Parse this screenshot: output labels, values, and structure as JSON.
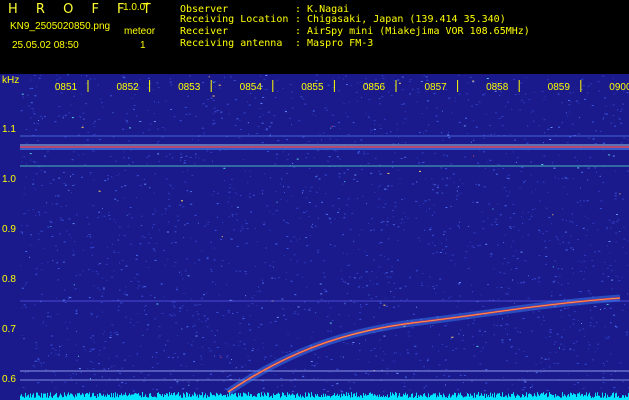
{
  "header": {
    "brand": "H R O F F T",
    "version": "1.0.0f",
    "filename": "KN9_2505020850.png",
    "meteor_label": "meteor",
    "datetime": "25.05.02 08:50",
    "meteor_count": "1"
  },
  "info": [
    {
      "key": "Observer",
      "value": ": K.Nagai"
    },
    {
      "key": "Receiving Location",
      "value": ": Chigasaki, Japan (139.414 35.340)"
    },
    {
      "key": "Receiver",
      "value": ": AirSpy mini (Miakejima VOR 108.65MHz)"
    },
    {
      "key": "Receiving antenna",
      "value": ": Maspro FM-3"
    }
  ],
  "spectrogram": {
    "y_unit": "kHz",
    "y_ticks": [
      "1.1",
      "1.0",
      "0.9",
      "0.8",
      "0.7",
      "0.6"
    ],
    "x_ticks": [
      "0851",
      "0852",
      "0853",
      "0854",
      "0855",
      "0856",
      "0857",
      "0858",
      "0859",
      "0900"
    ],
    "colors": {
      "background": "#1a1a8c",
      "noise": "#3a4ad0",
      "signal": "#ff3030",
      "baseline": "#00e5ff",
      "label": "#ffff00"
    }
  }
}
